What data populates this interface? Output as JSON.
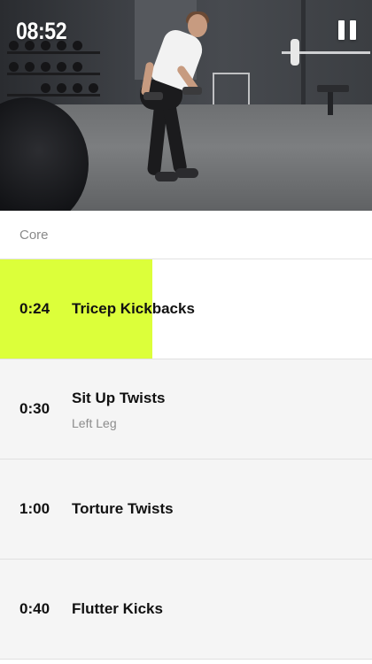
{
  "player": {
    "elapsed_time": "08:52",
    "pause_icon": "pause-icon"
  },
  "workout": {
    "section_title": "Core",
    "exercises": [
      {
        "time": "0:24",
        "name": "Tricep Kickbacks",
        "subtitle": "",
        "progress": 0.41,
        "active": true
      },
      {
        "time": "0:30",
        "name": "Sit Up Twists",
        "subtitle": "Left Leg",
        "active": false
      },
      {
        "time": "1:00",
        "name": "Torture Twists",
        "subtitle": "",
        "active": false
      },
      {
        "time": "0:40",
        "name": "Flutter Kicks",
        "subtitle": "",
        "active": false
      }
    ]
  },
  "colors": {
    "progress_fill": "#dcff3a",
    "inactive_row_bg": "#f5f5f5",
    "active_row_bg": "#ffffff"
  }
}
